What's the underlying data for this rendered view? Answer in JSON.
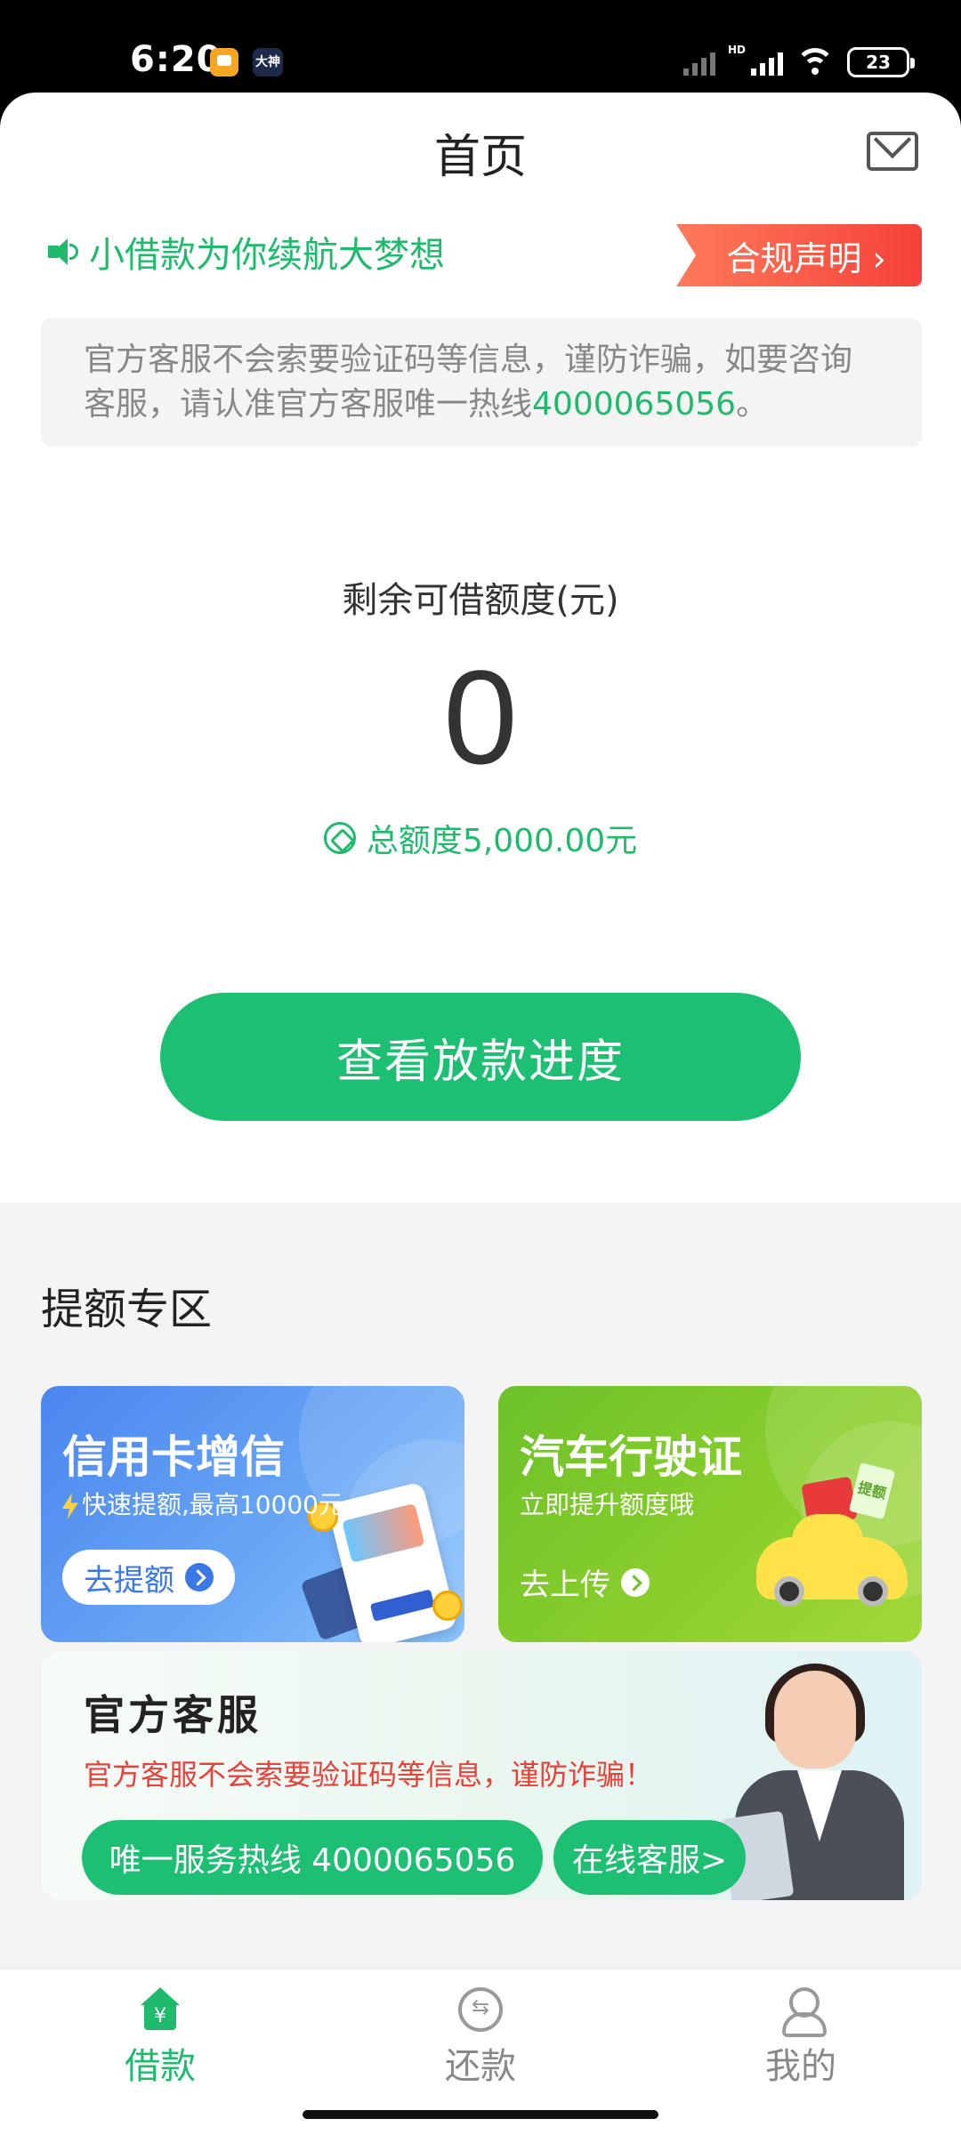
{
  "status_bar": {
    "time": "6:20",
    "app_badge": "大神",
    "network": "HD",
    "battery": "23"
  },
  "header": {
    "title": "首页"
  },
  "announcement": {
    "slogan": "小借款为你续航大梦想",
    "compliance_label": "合规声明 ›"
  },
  "notice": {
    "text": "官方客服不会索要验证码等信息，谨防诈骗，如要咨询客服，请认准官方客服唯一热线",
    "hotline": "4000065056",
    "suffix": "。"
  },
  "quota": {
    "label": "剩余可借额度(元)",
    "value": "0",
    "total": "总额度5,000.00元"
  },
  "main_button": {
    "label": "查看放款进度"
  },
  "boost_section": {
    "title": "提额专区",
    "cards": [
      {
        "title": "信用卡增信",
        "subtitle": "快速提额,最高10000元",
        "cta": "去提额"
      },
      {
        "title": "汽车行驶证",
        "subtitle": "立即提升额度哦",
        "cta": "去上传"
      }
    ],
    "car_tag": "提额"
  },
  "service": {
    "title": "官方客服",
    "warning": "官方客服不会索要验证码等信息，谨防诈骗！",
    "hotline_label": "唯一服务热线 4000065056",
    "online_label": "在线客服>"
  },
  "tabbar": {
    "items": [
      {
        "label": "借款",
        "icon": "home-icon",
        "active": true
      },
      {
        "label": "还款",
        "icon": "repay-icon",
        "active": false
      },
      {
        "label": "我的",
        "icon": "user-icon",
        "active": false
      }
    ]
  },
  "colors": {
    "brand_green": "#1fba6c",
    "button_green": "#1dbf73",
    "warning_red": "#e8413a"
  }
}
